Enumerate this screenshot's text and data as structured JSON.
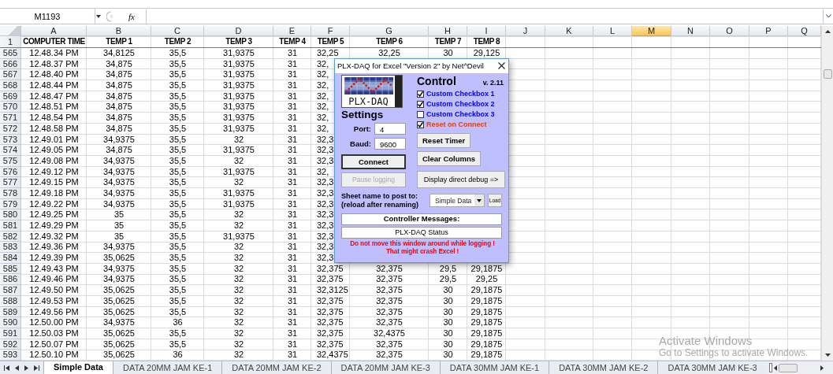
{
  "formula_bar": {
    "name_box": "M1193",
    "function_label": "fx"
  },
  "columns": [
    {
      "letter": "A",
      "selected": false
    },
    {
      "letter": "B",
      "selected": false
    },
    {
      "letter": "C",
      "selected": false
    },
    {
      "letter": "D",
      "selected": false
    },
    {
      "letter": "E",
      "selected": false
    },
    {
      "letter": "F",
      "selected": false
    },
    {
      "letter": "G",
      "selected": false
    },
    {
      "letter": "H",
      "selected": false
    },
    {
      "letter": "I",
      "selected": false
    },
    {
      "letter": "J",
      "selected": false
    },
    {
      "letter": "K",
      "selected": false
    },
    {
      "letter": "L",
      "selected": false
    },
    {
      "letter": "M",
      "selected": true
    },
    {
      "letter": "N",
      "selected": false
    },
    {
      "letter": "O",
      "selected": false
    },
    {
      "letter": "P",
      "selected": false
    },
    {
      "letter": "Q",
      "selected": false
    }
  ],
  "header_row": {
    "number": "1",
    "cells": [
      "COMPUTER TIME",
      "TEMP 1",
      "TEMP 2",
      "TEMP 3",
      "TEMP 4",
      "TEMP 5",
      "TEMP 6",
      "TEMP 7",
      "TEMP 8"
    ]
  },
  "rows": [
    {
      "number": "565",
      "cells": [
        "12.48.34 PM",
        "34,8125",
        "35,5",
        "31,9375",
        "31",
        "32,25",
        "32,25",
        "30",
        "29,125"
      ]
    },
    {
      "number": "566",
      "cells": [
        "12.48.37 PM",
        "34,875",
        "35,5",
        "31,9375",
        "31",
        "32,"
      ]
    },
    {
      "number": "567",
      "cells": [
        "12.48.40 PM",
        "34,875",
        "35,5",
        "31,9375",
        "31",
        "32,"
      ]
    },
    {
      "number": "568",
      "cells": [
        "12.48.44 PM",
        "34,875",
        "35,5",
        "31,9375",
        "31",
        "32,"
      ]
    },
    {
      "number": "569",
      "cells": [
        "12.48.47 PM",
        "34,875",
        "35,5",
        "31,9375",
        "31",
        "32,"
      ]
    },
    {
      "number": "570",
      "cells": [
        "12.48.51 PM",
        "34,875",
        "35,5",
        "31,9375",
        "31",
        "32,"
      ]
    },
    {
      "number": "571",
      "cells": [
        "12.48.54 PM",
        "34,875",
        "35,5",
        "31,9375",
        "31",
        "32,"
      ]
    },
    {
      "number": "572",
      "cells": [
        "12.48.58 PM",
        "34,875",
        "35,5",
        "31,9375",
        "31",
        "32,"
      ]
    },
    {
      "number": "573",
      "cells": [
        "12.49.01 PM",
        "34,9375",
        "35,5",
        "32",
        "31",
        "32,3"
      ]
    },
    {
      "number": "574",
      "cells": [
        "12.49.05 PM",
        "34,875",
        "35,5",
        "31,9375",
        "31",
        "32,3"
      ]
    },
    {
      "number": "575",
      "cells": [
        "12.49.08 PM",
        "34,9375",
        "35,5",
        "32",
        "31",
        "32,3"
      ]
    },
    {
      "number": "576",
      "cells": [
        "12.49.12 PM",
        "34,9375",
        "35,5",
        "31,9375",
        "31",
        "32,"
      ]
    },
    {
      "number": "577",
      "cells": [
        "12.49.15 PM",
        "34,9375",
        "35,5",
        "32",
        "31",
        "32,3"
      ]
    },
    {
      "number": "578",
      "cells": [
        "12.49.18 PM",
        "34,9375",
        "35,5",
        "31,9375",
        "31",
        "32,3"
      ]
    },
    {
      "number": "579",
      "cells": [
        "12.49.22 PM",
        "34,9375",
        "35,5",
        "31,9375",
        "31",
        "32,3"
      ]
    },
    {
      "number": "580",
      "cells": [
        "12.49.25 PM",
        "35",
        "35,5",
        "32",
        "31",
        "32,3"
      ]
    },
    {
      "number": "581",
      "cells": [
        "12.49.29 PM",
        "35",
        "35,5",
        "32",
        "31",
        "32,3"
      ]
    },
    {
      "number": "582",
      "cells": [
        "12.49.32 PM",
        "35",
        "35,5",
        "31,9375",
        "31",
        "32,3"
      ]
    },
    {
      "number": "583",
      "cells": [
        "12.49.36 PM",
        "34,9375",
        "35,5",
        "32",
        "31",
        "32,3"
      ]
    },
    {
      "number": "584",
      "cells": [
        "12.49.39 PM",
        "35,0625",
        "35,5",
        "32",
        "31",
        "32,3"
      ]
    },
    {
      "number": "585",
      "cells": [
        "12.49.43 PM",
        "34,9375",
        "35,5",
        "32",
        "31",
        "32,375",
        "32,375",
        "29,5",
        "29,1875"
      ]
    },
    {
      "number": "586",
      "cells": [
        "12.49.46 PM",
        "34,9375",
        "35,5",
        "32",
        "31",
        "32,375",
        "32,375",
        "29,5",
        "29,25"
      ]
    },
    {
      "number": "587",
      "cells": [
        "12.49.50 PM",
        "35,0625",
        "35,5",
        "32",
        "31",
        "32,3125",
        "32,375",
        "30",
        "29,1875"
      ]
    },
    {
      "number": "588",
      "cells": [
        "12.49.53 PM",
        "35,0625",
        "35,5",
        "32",
        "31",
        "32,375",
        "32,375",
        "30",
        "29,1875"
      ]
    },
    {
      "number": "589",
      "cells": [
        "12.49.56 PM",
        "35,0625",
        "35,5",
        "32",
        "31",
        "32,375",
        "32,375",
        "30",
        "29,1875"
      ]
    },
    {
      "number": "590",
      "cells": [
        "12.50.00 PM",
        "34,9375",
        "36",
        "32",
        "31",
        "32,375",
        "32,375",
        "30",
        "29,1875"
      ]
    },
    {
      "number": "591",
      "cells": [
        "12.50.03 PM",
        "35,0625",
        "35,5",
        "32",
        "31",
        "32,375",
        "32,4375",
        "30",
        "29,1875"
      ]
    },
    {
      "number": "592",
      "cells": [
        "12.50.07 PM",
        "35,0625",
        "35,5",
        "32",
        "31",
        "32,375",
        "32,375",
        "30",
        "29,1875"
      ]
    },
    {
      "number": "593",
      "cells": [
        "12.50.10 PM",
        "35,0625",
        "36",
        "32",
        "31",
        "32,4375",
        "32,375",
        "30",
        "29,1875"
      ]
    }
  ],
  "dialog": {
    "title": "PLX-DAQ for Excel \"Version 2\" by Net^Devil",
    "logo_text": "PLX-DAQ",
    "settings": {
      "heading": "Settings",
      "fields": [
        {
          "label": "Port:",
          "value": "4"
        },
        {
          "label": "Baud:",
          "value": "9600"
        }
      ]
    },
    "left_buttons": [
      {
        "label": "Connect",
        "focused": true,
        "disabled": false
      },
      {
        "label": "Pause logging",
        "focused": false,
        "disabled": true
      }
    ],
    "control": {
      "heading": "Control",
      "version": "v. 2.11",
      "checkboxes": [
        {
          "label": "Custom Checkbox 1",
          "checked": true,
          "color": "#0000ff"
        },
        {
          "label": "Custom Checkbox 2",
          "checked": true,
          "color": "#0000ff"
        },
        {
          "label": "Custom Checkbox 3",
          "checked": false,
          "color": "#0000ff"
        },
        {
          "label": "Reset on Connect",
          "checked": true,
          "color": "#e0400c"
        }
      ]
    },
    "right_buttons": [
      {
        "label": "Reset Timer",
        "focused": false,
        "disabled": false
      },
      {
        "label": "Clear Columns",
        "focused": false,
        "disabled": false
      },
      {
        "label": "Display direct debug =>",
        "focused": false,
        "disabled": false
      }
    ],
    "sheet": {
      "label": "Sheet name to post to:\n(reload after renaming)",
      "selected": "Simple Data",
      "load_button": "Load"
    },
    "messages_title": "Controller Messages:",
    "status": "PLX-DAQ Status",
    "warning": "Do not move this window around while logging !\nThat might crash Excel !"
  },
  "activation_notice": {
    "title": "Activate Windows",
    "text": "Go to Settings to activate Windows."
  },
  "sheet_tabs": [
    {
      "label": "Simple Data",
      "selected": true
    },
    {
      "label": "DATA 20MM JAM KE-1",
      "selected": false
    },
    {
      "label": "DATA 20MM JAM KE-2",
      "selected": false
    },
    {
      "label": "DATA 20MM JAM KE-3",
      "selected": false
    },
    {
      "label": "DATA 30MM JAM KE-1",
      "selected": false
    },
    {
      "label": "DATA 30MM JAM KE-2",
      "selected": false
    },
    {
      "label": "DATA 30MM JAM KE-3",
      "selected": false
    }
  ]
}
